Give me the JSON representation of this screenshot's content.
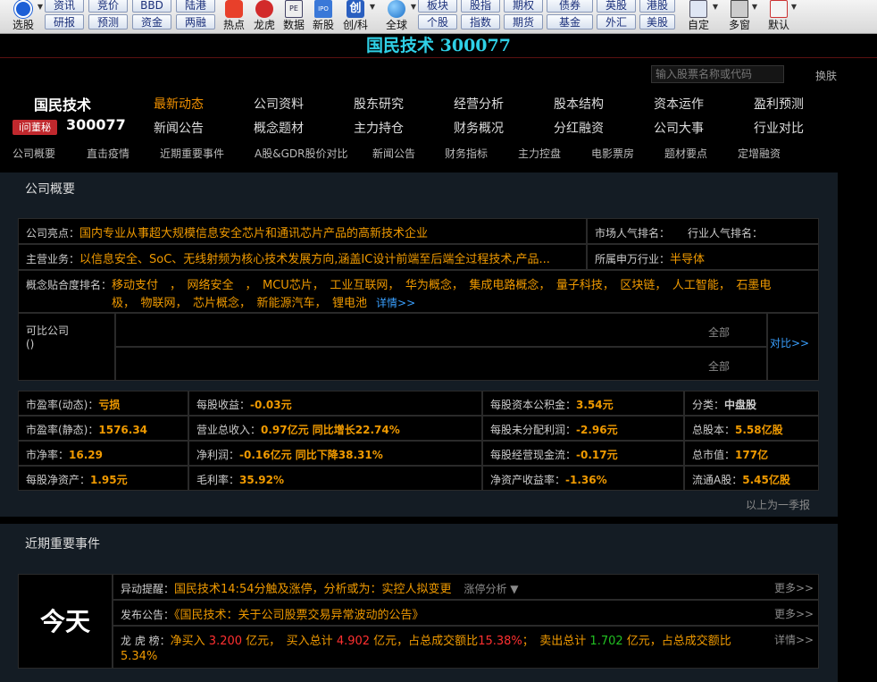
{
  "toolbar": {
    "big_left": [
      {
        "label": "选股",
        "icon": "chart-arrow-icon"
      }
    ],
    "small_groups": [
      {
        "top": "资讯",
        "bottom": "研报"
      },
      {
        "top": "竞价",
        "bottom": "预测"
      },
      {
        "top": "BBD",
        "bottom": "资金"
      },
      {
        "top": "陆港",
        "bottom": "两融"
      }
    ],
    "big_mid": [
      {
        "label": "热点",
        "icon": "hot-icon"
      },
      {
        "label": "龙虎",
        "icon": "dragon-tiger-icon"
      },
      {
        "label": "数据",
        "icon": "pe-data-icon"
      },
      {
        "label": "新股",
        "icon": "ipo-icon"
      },
      {
        "label": "创/科",
        "icon": "chuang-icon"
      },
      {
        "label": "全球",
        "icon": "globe-icon"
      }
    ],
    "small_groups2": [
      {
        "top": "板块",
        "bottom": "个股"
      },
      {
        "top": "股指",
        "bottom": "指数"
      },
      {
        "top": "期权",
        "bottom": "期货"
      },
      {
        "top": "债券",
        "bottom": "基金"
      },
      {
        "top": "英股",
        "bottom": "外汇"
      },
      {
        "top": "港股",
        "bottom": "美股"
      }
    ],
    "big_right": [
      {
        "label": "自定",
        "icon": "custom-icon"
      },
      {
        "label": "多窗",
        "icon": "multi-window-icon"
      },
      {
        "label": "默认",
        "icon": "home-icon"
      }
    ]
  },
  "title": "国民技术 300077",
  "search": {
    "placeholder": "输入股票名称或代码",
    "swap_label": "换肤"
  },
  "stock": {
    "name": "国民技术",
    "code": "300077",
    "badge": "i问董秘"
  },
  "nav": {
    "row1": [
      "最新动态",
      "公司资料",
      "股东研究",
      "经营分析",
      "股本结构",
      "资本运作",
      "盈利预测"
    ],
    "row2": [
      "新闻公告",
      "概念题材",
      "主力持仓",
      "财务概况",
      "分红融资",
      "公司大事",
      "行业对比"
    ],
    "active": "最新动态"
  },
  "subnav": [
    "公司概要",
    "直击疫情",
    "近期重要事件",
    "A股&GDR股价对比",
    "新闻公告",
    "财务指标",
    "主力控盘",
    "电影票房",
    "题材要点",
    "定增融资"
  ],
  "overview": {
    "section_title": "公司概要",
    "highlight_label": "公司亮点：",
    "highlight": "国内专业从事超大规模信息安全芯片和通讯芯片产品的高新技术企业",
    "market_rank_label": "市场人气排名：",
    "industry_rank_label": "行业人气排名：",
    "business_label": "主营业务：",
    "business": "以信息安全、SoC、无线射频为核心技术发展方向,涵盖IC设计前端至后端全过程技术,产品...",
    "industry_label": "所属申万行业：",
    "industry": "半导体",
    "concept_label": "概念贴合度排名：",
    "concepts_line1": "移动支付　，　网络安全　，　MCU芯片，　工业互联网，　华为概念，　集成电路概念，　量子科技，　区块链，　人工智能，　石墨电",
    "concepts_line2": "极，　物联网，　芯片概念，　新能源汽车，　锂电池",
    "concept_more": "详情>>",
    "peer_label": "可比公司",
    "peer_paren": "()",
    "peer_all_1": "全部",
    "peer_all_2": "全部",
    "compare": "对比>>"
  },
  "metrics": [
    [
      {
        "l": "市盈率(动态)：",
        "v": "亏损"
      },
      {
        "l": "每股收益：",
        "v": "-0.03元"
      },
      {
        "l": "每股资本公积金：",
        "v": "3.54元"
      },
      {
        "l": "分类：",
        "v": "中盘股",
        "plain": true
      }
    ],
    [
      {
        "l": "市盈率(静态)：",
        "v": "1576.34"
      },
      {
        "l": "营业总收入：",
        "v": "0.97亿元 同比增长22.74%"
      },
      {
        "l": "每股未分配利润：",
        "v": "-2.96元"
      },
      {
        "l": "总股本：",
        "v": "5.58亿股"
      }
    ],
    [
      {
        "l": "市净率：",
        "v": "16.29"
      },
      {
        "l": "净利润：",
        "v": "-0.16亿元 同比下降38.31%"
      },
      {
        "l": "每股经营现金流：",
        "v": "-0.17元"
      },
      {
        "l": "总市值：",
        "v": "177亿"
      }
    ],
    [
      {
        "l": "每股净资产：",
        "v": "1.95元"
      },
      {
        "l": "毛利率：",
        "v": "35.92%"
      },
      {
        "l": "净资产收益率：",
        "v": "-1.36%"
      },
      {
        "l": "流通A股：",
        "v": "5.45亿股"
      }
    ]
  ],
  "metrics_note": "以上为一季报",
  "events": {
    "section_title": "近期重要事件",
    "today": "今天",
    "more": "更多>>",
    "detail": "详情>>",
    "alert_label": "异动提醒：",
    "alert": "国民技术14:54分触及涨停，分析或为：实控人拟变更",
    "alert_link": "涨停分析 ▼",
    "notice_label": "发布公告：",
    "notice": "《国民技术：关于公司股票交易异常波动的公告》",
    "lhb_label": "龙 虎 榜：",
    "lhb_t1": "净买入",
    "lhb_v1": "3.200",
    "lhb_t2": "亿元，　买入总计",
    "lhb_v2": "4.902",
    "lhb_t3": "亿元，占总成交额比",
    "lhb_p1": "15.38%",
    "lhb_t4": "；　卖出总计",
    "lhb_v3": "1.702",
    "lhb_t5": "亿元，占总成交额比",
    "lhb_p2": "5.34%"
  }
}
